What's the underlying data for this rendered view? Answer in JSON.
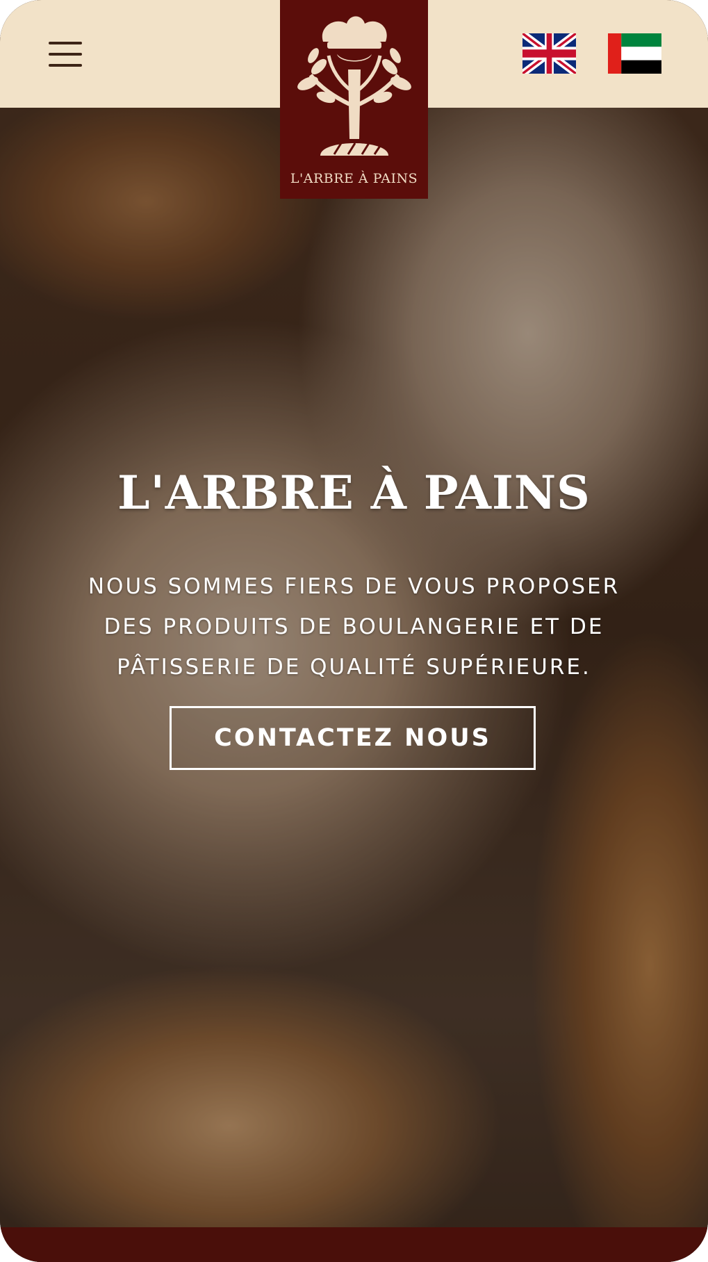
{
  "header": {
    "menu_icon": "hamburger-menu-icon",
    "logo_name": "L'ARBRE À PAINS",
    "logo_icon": "tree-bread-logo",
    "languages": [
      {
        "name": "uk-flag-icon"
      },
      {
        "name": "uae-flag-icon"
      }
    ]
  },
  "hero": {
    "title": "L'ARBRE À PAINS",
    "tagline_lines": [
      "NOUS SOMMES FIERS DE VOUS PROPOSER",
      "DES PRODUITS DE BOULANGERIE ET DE",
      "PÂTISSERIE DE QUALITÉ SUPÉRIEURE."
    ],
    "cta_label": "CONTACTEZ NOUS"
  },
  "colors": {
    "topbar": "#f2e2c8",
    "logo_bg": "#5b0d0a",
    "footer": "#4a0f0a",
    "text_light": "#ffffff"
  }
}
